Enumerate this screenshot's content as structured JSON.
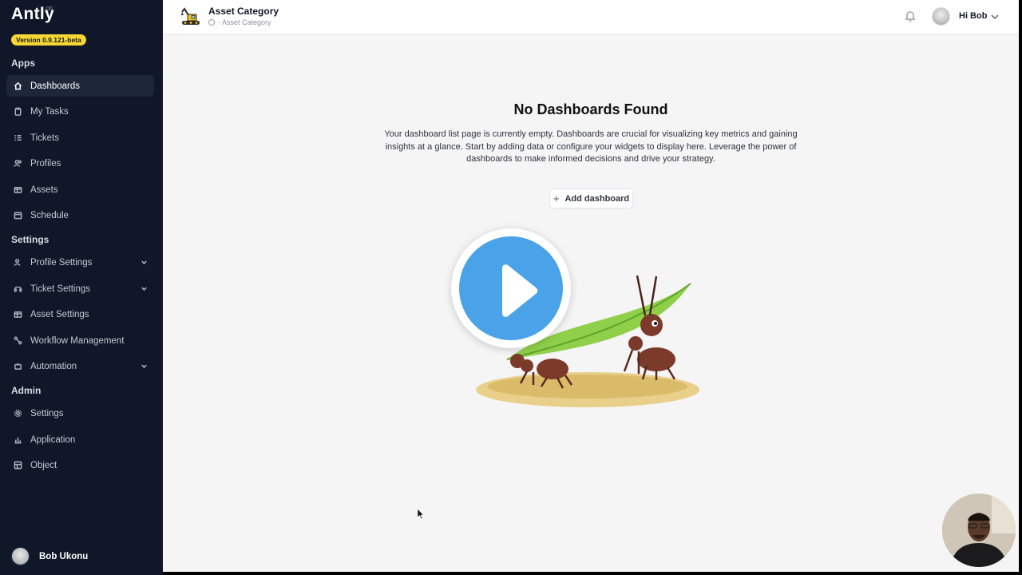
{
  "app": {
    "logo": "Antly",
    "logo_sup": "00",
    "version": "Version 0.9.121-beta"
  },
  "sidebar": {
    "sections": {
      "apps": "Apps",
      "settings": "Settings",
      "admin": "Admin"
    },
    "items": [
      {
        "label": "Dashboards",
        "icon": "home-icon",
        "active": true
      },
      {
        "label": "My Tasks",
        "icon": "clipboard-icon"
      },
      {
        "label": "Tickets",
        "icon": "list-icon"
      },
      {
        "label": "Profiles",
        "icon": "users-icon"
      },
      {
        "label": "Assets",
        "icon": "box-icon"
      },
      {
        "label": "Schedule",
        "icon": "calendar-icon"
      },
      {
        "label": "Profile Settings",
        "icon": "user-cog-icon",
        "expandable": true
      },
      {
        "label": "Ticket Settings",
        "icon": "headset-icon",
        "expandable": true
      },
      {
        "label": "Asset Settings",
        "icon": "box-cog-icon"
      },
      {
        "label": "Workflow Management",
        "icon": "workflow-icon"
      },
      {
        "label": "Automation",
        "icon": "robot-icon",
        "expandable": true
      },
      {
        "label": "Settings",
        "icon": "gear-icon"
      },
      {
        "label": "Application",
        "icon": "chart-icon"
      },
      {
        "label": "Object",
        "icon": "table-icon"
      }
    ],
    "user_name": "Bob Ukonu"
  },
  "header": {
    "title": "Asset Category",
    "breadcrumb": "- Asset Category",
    "greeting": "Hi Bob"
  },
  "main": {
    "heading": "No Dashboards Found",
    "description": "Your dashboard list page is currently empty. Dashboards are crucial for visualizing key metrics and gaining insights at a glance. Start by adding data or configure your widgets to display here. Leverage the power of dashboards to make informed decisions and drive your strategy.",
    "add_button": "Add dashboard"
  },
  "colors": {
    "sidebar_bg": "#0f1729",
    "play_blue": "#4aa3e8",
    "version_badge": "#f5d632"
  }
}
